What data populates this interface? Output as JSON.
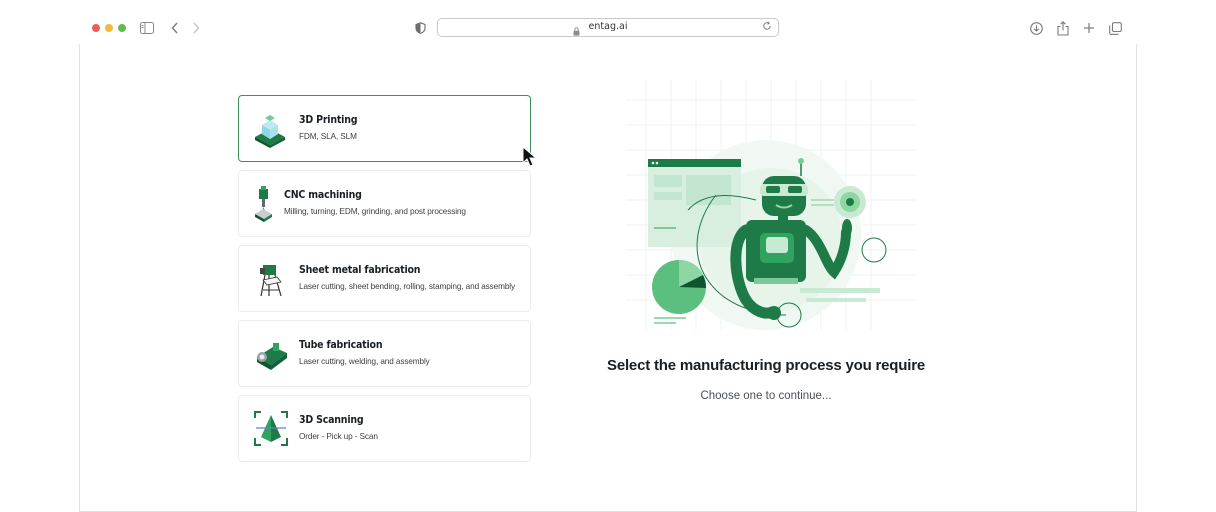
{
  "browser": {
    "url": "entag.ai",
    "icons": [
      "sidebar-icon",
      "back-icon",
      "forward-icon",
      "privacy-shield-icon",
      "lock-icon",
      "reload-icon",
      "download-icon",
      "share-icon",
      "new-tab-icon",
      "tabs-overview-icon"
    ],
    "traffic_colors": {
      "close": "#ee5d55",
      "minimize": "#f3b93b",
      "zoom": "#5cbd4a"
    }
  },
  "options": [
    {
      "title": "3D Printing",
      "subtitle": "FDM, SLA, SLM",
      "icon": "3d-printing-icon",
      "selected": true
    },
    {
      "title": "CNC machining",
      "subtitle": "Milling, turning, EDM, grinding, and post processing",
      "icon": "cnc-machining-icon",
      "selected": false
    },
    {
      "title": "Sheet metal fabrication",
      "subtitle": "Laser cutting, sheet bending, rolling, stamping, and assembly",
      "icon": "sheet-metal-icon",
      "selected": false
    },
    {
      "title": "Tube fabrication",
      "subtitle": "Laser cutting, welding, and assembly",
      "icon": "tube-fabrication-icon",
      "selected": false
    },
    {
      "title": "3D Scanning",
      "subtitle": "Order - Pick up - Scan",
      "icon": "3d-scanning-icon",
      "selected": false
    }
  ],
  "main": {
    "headline": "Select the manufacturing process you require",
    "subline": "Choose one to continue..."
  },
  "colors": {
    "accent": "#1e7a46",
    "accent_light": "#8fd6a5",
    "selected_border": "#3f8f5b"
  }
}
